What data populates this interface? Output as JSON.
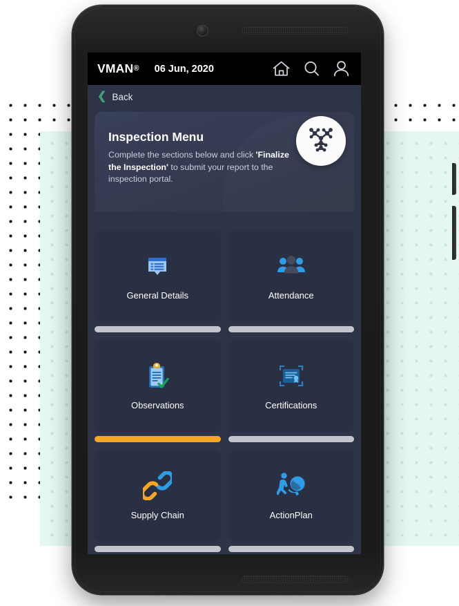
{
  "device": {
    "camera": "camera-lens",
    "speaker_top": "earpiece-speaker",
    "speaker_bottom": "bottom-speaker"
  },
  "appbar": {
    "brand": "VMAN",
    "brand_mark": "®",
    "date": "06 Jun, 2020",
    "icons": [
      {
        "name": "home-icon",
        "label": "Home"
      },
      {
        "name": "search-icon",
        "label": "Search"
      },
      {
        "name": "user-icon",
        "label": "Profile"
      }
    ]
  },
  "backbar": {
    "chevron": "❮",
    "label": "Back"
  },
  "panel": {
    "title": "Inspection Menu",
    "desc_part1": "Complete the sections below and click ",
    "desc_bold1": "'Finalize the Inspection'",
    "desc_part2": " to submit your report to the inspection portal.",
    "badge_icon": "molecule-cluster-logo"
  },
  "colors": {
    "appbar_bg": "#000000",
    "screen_bg": "#2e3448",
    "panel_bg": "#373d55",
    "tile_bg": "#2a3044",
    "accent_orange": "#f5a623",
    "bar_gray": "#c2c6cc",
    "back_green": "#3fa07a",
    "icon_blue": "#3b9ae1",
    "mint_block": "#e4f8ef"
  },
  "tiles": [
    {
      "label": "General Details",
      "icon": "document-list-icon",
      "progress_color": "gray",
      "progress": 100
    },
    {
      "label": "Attendance",
      "icon": "people-group-icon",
      "progress_color": "gray",
      "progress": 100
    },
    {
      "label": "Observations",
      "icon": "clipboard-check-icon",
      "progress_color": "orange",
      "progress": 100
    },
    {
      "label": "Certifications",
      "icon": "certificate-icon",
      "progress_color": "gray",
      "progress": 100
    },
    {
      "label": "Supply Chain",
      "icon": "chain-link-icon",
      "progress_color": "gray",
      "progress": 100
    },
    {
      "label": "ActionPlan",
      "icon": "person-globe-icon",
      "progress_color": "gray",
      "progress": 100
    }
  ]
}
